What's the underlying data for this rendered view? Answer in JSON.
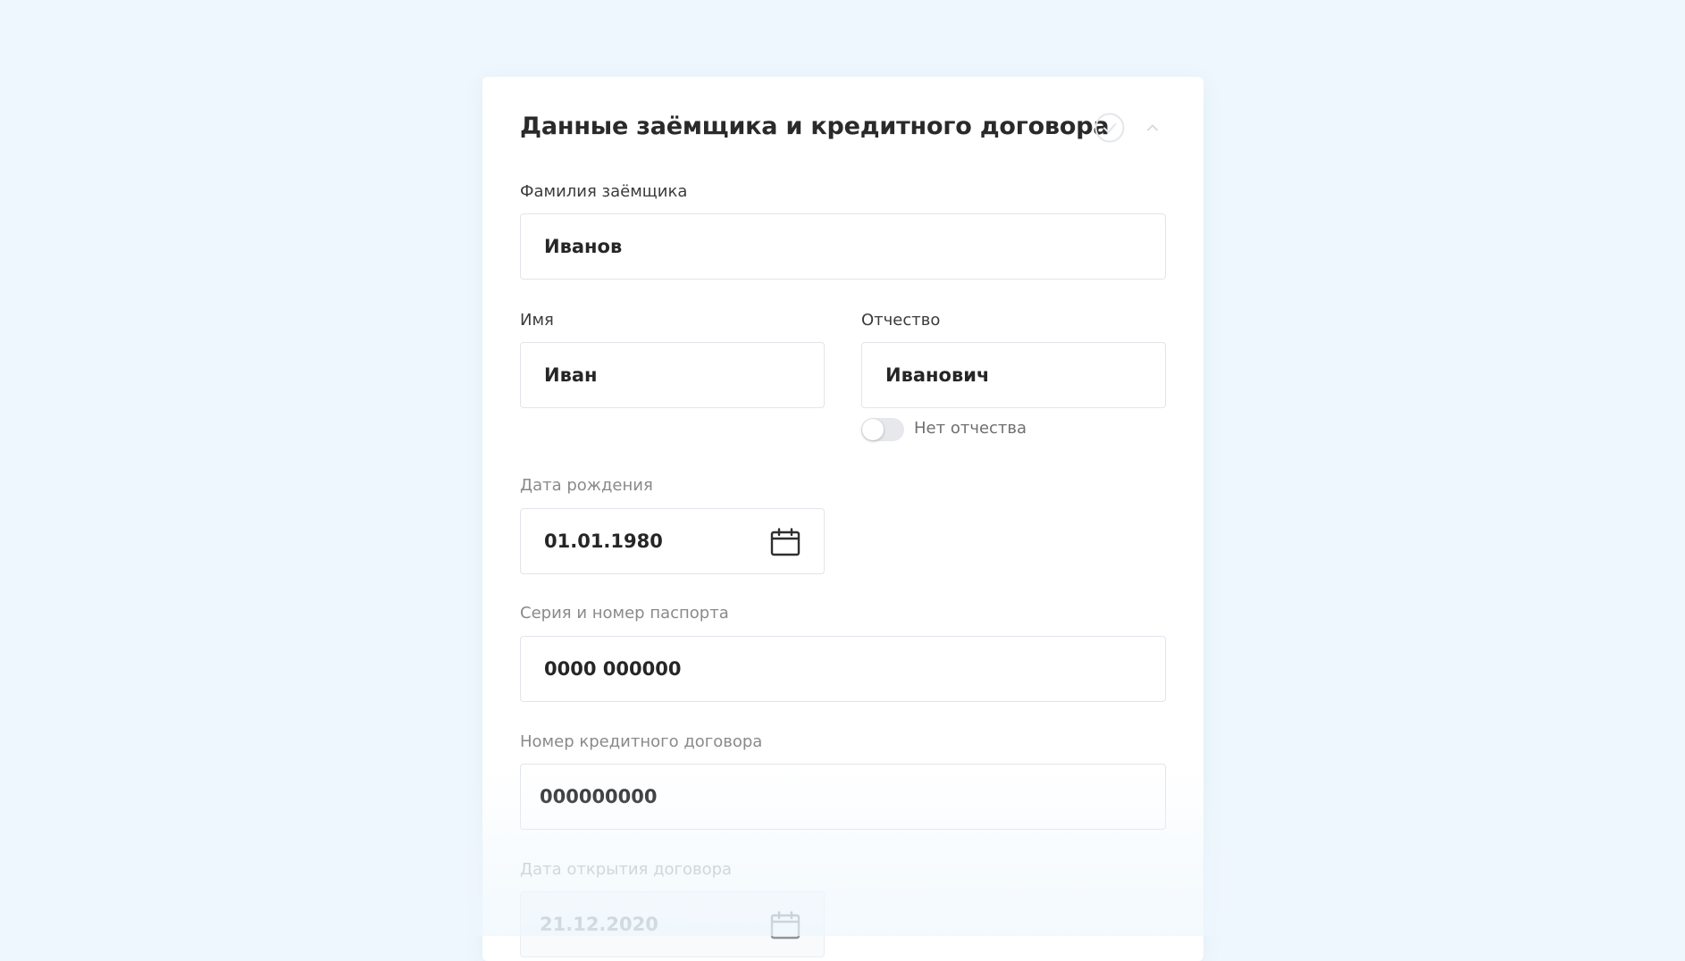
{
  "form": {
    "title": "Данные заёмщика и кредитного договора",
    "surname": {
      "label": "Фамилия заёмщика",
      "value": "Иванов"
    },
    "first_name": {
      "label": "Имя",
      "value": "Иван"
    },
    "patronymic": {
      "label": "Отчество",
      "value": "Иванович"
    },
    "no_patronymic": {
      "label": "Нет отчества",
      "checked": false
    },
    "birth_date": {
      "label": "Дата рождения",
      "value": "01.01.1980"
    },
    "passport": {
      "label": "Серия и номер паспорта",
      "value": "0000 000000"
    },
    "contract_number": {
      "label": "Номер кредитного договора",
      "value": "000000000"
    },
    "contract_open_date": {
      "label": "Дата открытия договора",
      "value": "21.12.2020"
    }
  },
  "icons": {
    "status": "check-circle-icon",
    "collapse": "chevron-up-icon",
    "calendar": "calendar-icon"
  },
  "colors": {
    "page_background": "#eef7fd",
    "card_background": "#ffffff",
    "field_border": "#e1e5ea",
    "text_primary": "#262626"
  }
}
